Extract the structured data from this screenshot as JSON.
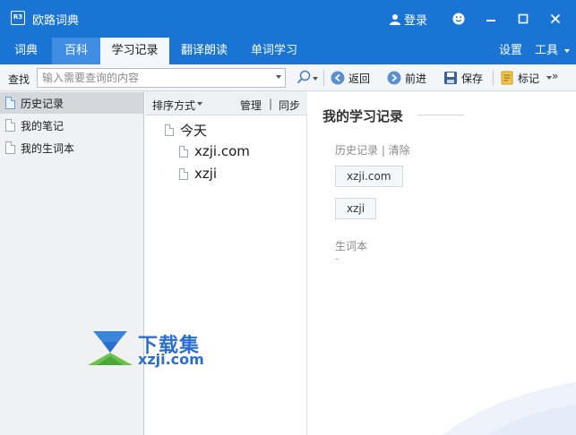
{
  "app": {
    "title": "欧路词典",
    "logo_text": "R3"
  },
  "titlebar": {
    "login_label": "登录",
    "icons": [
      "user-icon",
      "emoji-icon",
      "minimize-icon",
      "maximize-icon",
      "close-icon"
    ]
  },
  "tabs": [
    {
      "label": "词典"
    },
    {
      "label": "百科"
    },
    {
      "label": "学习记录"
    },
    {
      "label": "翻译朗读"
    },
    {
      "label": "单词学习"
    }
  ],
  "tabs_right": {
    "settings": "设置",
    "tools": "工具"
  },
  "toolbar": {
    "find_label": "查找",
    "search_placeholder": "输入需要查询的内容",
    "back": "返回",
    "forward": "前进",
    "save": "保存",
    "mark": "标记",
    "overflow": "»"
  },
  "sidebar": {
    "items": [
      {
        "label": "历史记录",
        "selected": true
      },
      {
        "label": "我的笔记",
        "selected": false
      },
      {
        "label": "我的生词本",
        "selected": false
      }
    ]
  },
  "middle": {
    "sort_label": "排序方式",
    "manage_label": "管理",
    "separator": "|",
    "sync_label": "同步",
    "tree": [
      {
        "label": "今天"
      },
      {
        "label": "xzji.com"
      },
      {
        "label": "xzji"
      }
    ]
  },
  "watermark": {
    "cn": "下载集",
    "en": "xzji.com"
  },
  "record": {
    "title": "我的学习记录",
    "history_label": "历史记录 | 清除",
    "history_items": [
      "xzji.com",
      "xzji"
    ],
    "vocab_label": "生词本",
    "vocab_empty": "-"
  },
  "colors": {
    "accent": "#1a74d4",
    "watermark": "#2a6fd0"
  }
}
